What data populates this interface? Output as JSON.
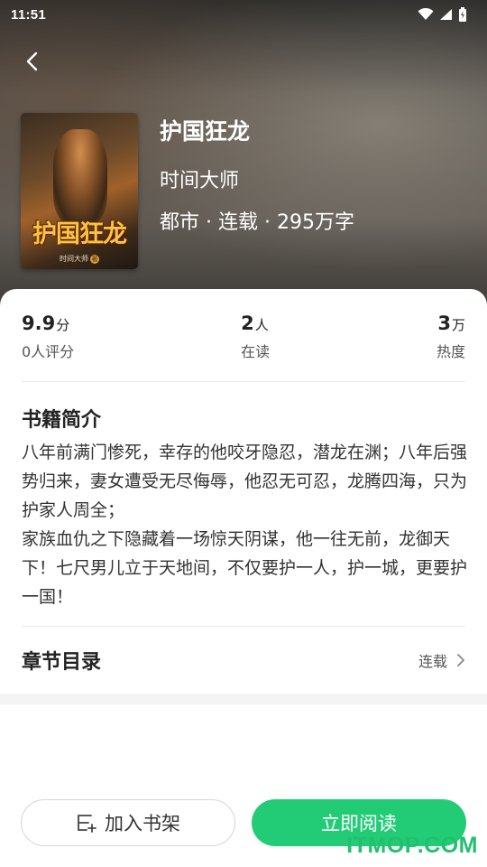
{
  "status_bar": {
    "time": "11:51"
  },
  "book": {
    "title": "护国狂龙",
    "author": "时间大师",
    "meta": "都市 · 连载 · 295万字",
    "cover_title": "护国狂龙",
    "cover_author": "时间大师",
    "cover_badge": "著"
  },
  "stats": [
    {
      "value": "9.9",
      "unit": "分",
      "label": "0人评分"
    },
    {
      "value": "2",
      "unit": "人",
      "label": "在读"
    },
    {
      "value": "3",
      "unit": "万",
      "label": "热度"
    }
  ],
  "intro": {
    "title": "书籍简介",
    "paragraphs": [
      "八年前满门惨死，幸存的他咬牙隐忍，潜龙在渊；八年后强势归来，妻女遭受无尽侮辱，他忍无可忍，龙腾四海，只为护家人周全；",
      "家族血仇之下隐藏着一场惊天阴谋，他一往无前，龙御天下！七尺男儿立于天地间，不仅要护一人，护一城，更要护一国！"
    ]
  },
  "toc": {
    "title": "章节目录",
    "status": "连载"
  },
  "buttons": {
    "add_shelf": "加入书架",
    "read_now": "立即阅读"
  },
  "watermark": "ITMOP.COM",
  "colors": {
    "accent": "#22cc77",
    "watermark": "#22c06e"
  }
}
